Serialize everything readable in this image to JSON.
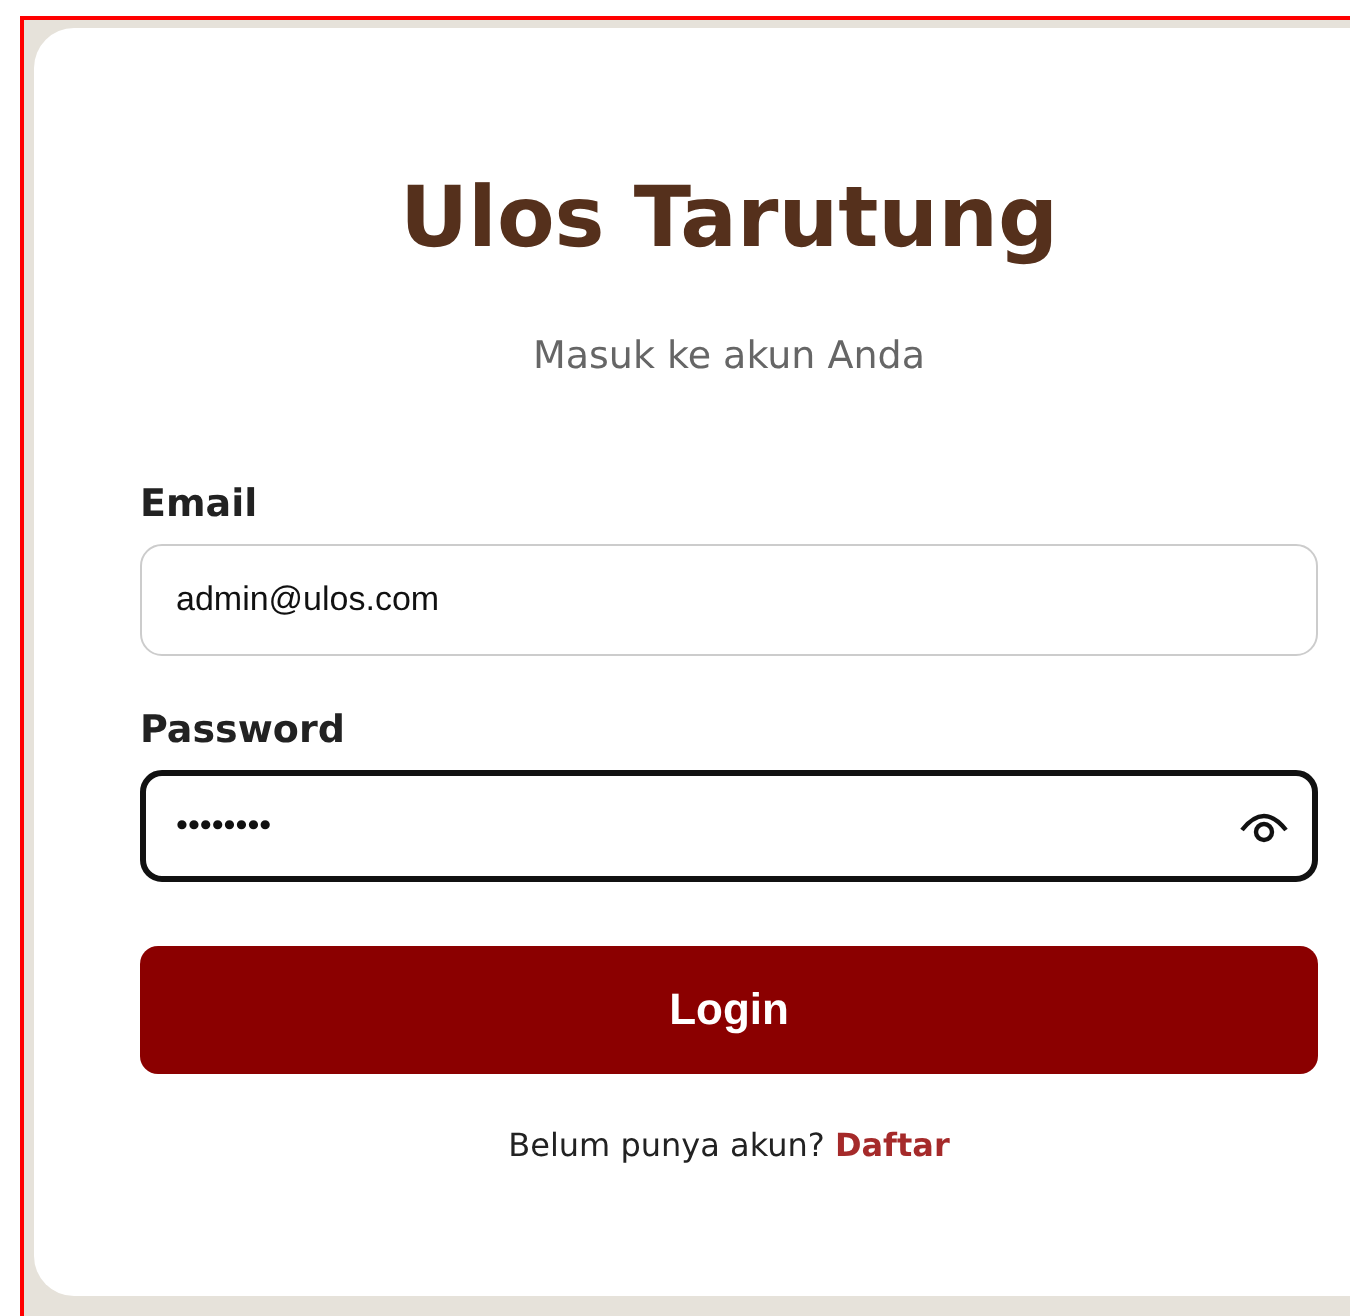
{
  "title": "Ulos Tarutung",
  "subtitle": "Masuk ke akun Anda",
  "fields": [
    {
      "kind": "email",
      "label": "Email",
      "value": "admin@ulos.com",
      "focused": false
    },
    {
      "kind": "password",
      "label": "Password",
      "value": "••••••••",
      "focused": true
    }
  ],
  "submit": {
    "label": "Login"
  },
  "footer": {
    "text": "Belum punya akun?",
    "link": "Daftar"
  }
}
